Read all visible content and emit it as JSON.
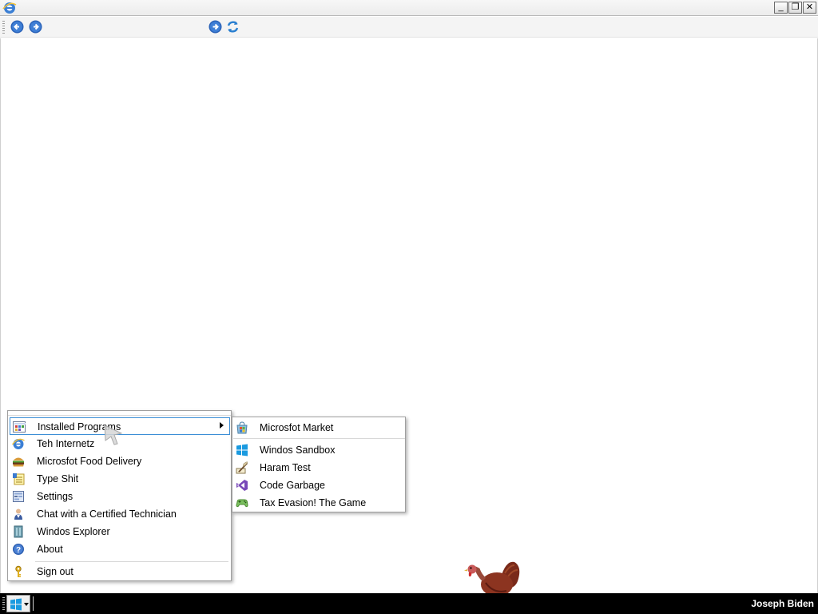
{
  "window": {
    "app_icon": "internet-explorer-icon",
    "controls": {
      "minimize": "_",
      "maximize": "❐",
      "close": "✕"
    }
  },
  "navbar": {
    "back_icon": "back-arrow-icon",
    "forward_icon": "forward-arrow-icon",
    "address_value": "",
    "go_icon": "go-arrow-icon",
    "refresh_icon": "refresh-icon"
  },
  "start_menu": {
    "items": [
      {
        "label": "Installed Programs",
        "icon": "programs-grid-icon",
        "has_submenu": true,
        "selected": true
      },
      {
        "label": "Teh Internetz",
        "icon": "internet-explorer-icon"
      },
      {
        "label": "Microsfot Food Delivery",
        "icon": "burger-icon"
      },
      {
        "label": "Type Shit",
        "icon": "notepad-icon"
      },
      {
        "label": "Settings",
        "icon": "settings-icon"
      },
      {
        "label": "Chat with a Certified Technician",
        "icon": "technician-icon"
      },
      {
        "label": "Windos Explorer",
        "icon": "explorer-icon"
      },
      {
        "label": "About",
        "icon": "help-icon"
      }
    ],
    "sign_out": {
      "label": "Sign out",
      "icon": "key-icon"
    }
  },
  "submenu": {
    "items": [
      {
        "label": "Microsfot Market",
        "icon": "market-icon"
      },
      {
        "label": "Windos Sandbox",
        "icon": "windows-logo-icon"
      },
      {
        "label": "Haram Test",
        "icon": "quill-icon"
      },
      {
        "label": "Code Garbage",
        "icon": "visual-studio-icon"
      },
      {
        "label": "Tax Evasion! The Game",
        "icon": "game-controller-icon"
      }
    ]
  },
  "taskbar": {
    "start_icon": "windows-logo-icon",
    "user_name": "Joseph Biden"
  },
  "colors": {
    "selection_border": "#3d8fd6",
    "taskbar_bg": "#000000",
    "nav_arrow_blue": "#2a62b8"
  }
}
